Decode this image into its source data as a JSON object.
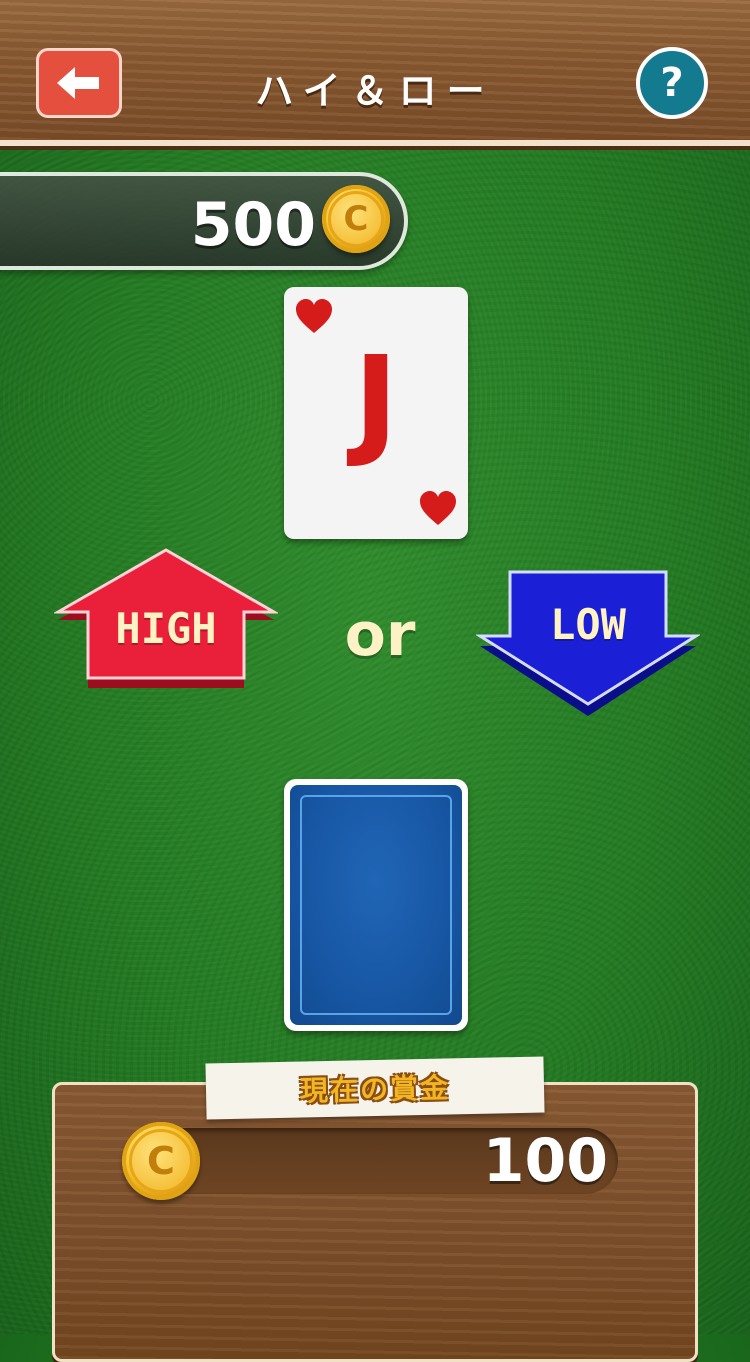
{
  "header": {
    "title": "ハイ＆ロー",
    "back_icon": "back-arrow-icon",
    "help_label": "?"
  },
  "balance": {
    "amount": "500",
    "coin_letter": "C"
  },
  "current_card": {
    "rank": "J",
    "suit": "hearts",
    "color": "#d61b1b"
  },
  "next_card": {
    "face_down": true
  },
  "choices": {
    "high_label": "HIGH",
    "or_label": "or",
    "low_label": "LOW"
  },
  "prize": {
    "label": "現在の賞金",
    "amount": "100",
    "coin_letter": "C"
  },
  "colors": {
    "felt": "#237a22",
    "high": "#e8203a",
    "low": "#1b1fd6",
    "wood": "#8a5a31"
  }
}
